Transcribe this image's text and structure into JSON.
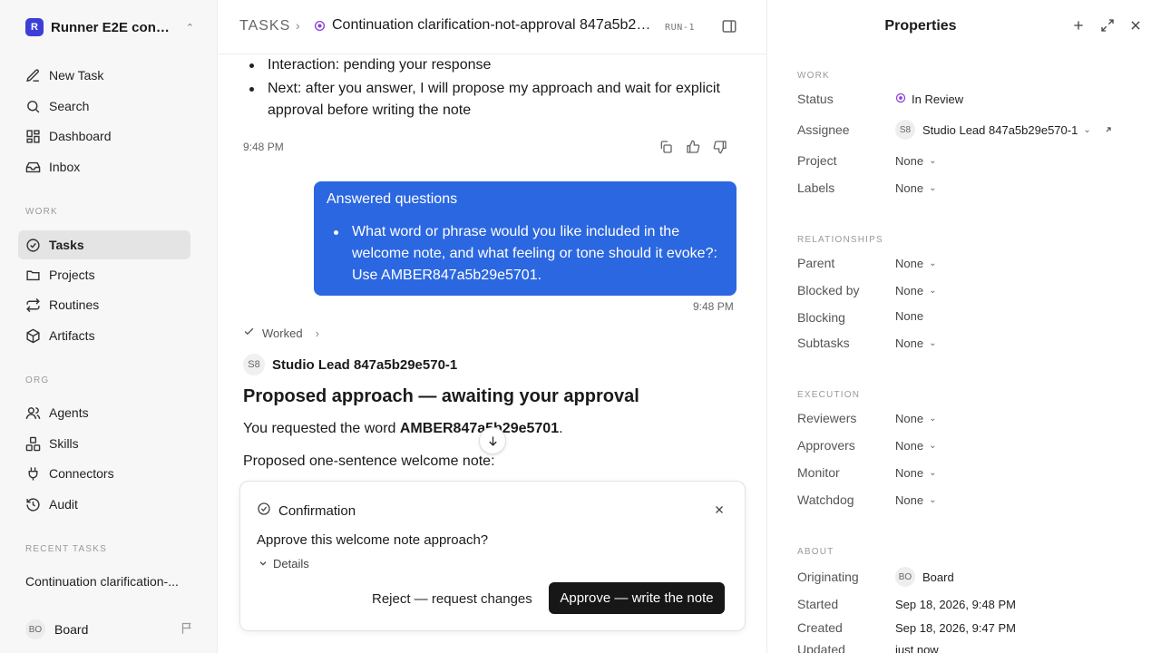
{
  "workspace": {
    "logo": "R",
    "name": "Runner E2E conti..."
  },
  "nav": {
    "new_task": "New Task",
    "search": "Search",
    "dashboard": "Dashboard",
    "inbox": "Inbox",
    "work_label": "WORK",
    "tasks": "Tasks",
    "projects": "Projects",
    "routines": "Routines",
    "artifacts": "Artifacts",
    "org_label": "ORG",
    "agents": "Agents",
    "skills": "Skills",
    "connectors": "Connectors",
    "audit": "Audit",
    "recent_label": "RECENT TASKS",
    "recent_task": "Continuation clarification-..."
  },
  "user": {
    "initials": "BO",
    "name": "Board"
  },
  "header": {
    "crumb": "TASKS",
    "title": "Continuation clarification-not-approval 847a5b29e5...",
    "run_id": "RUN-1"
  },
  "thread": {
    "bullet_1": "Interaction: pending your response",
    "bullet_2": "Next: after you answer, I will propose my approach and wait for explicit approval before writing the note",
    "time_1": "9:48 PM",
    "answer_title": "Answered questions",
    "answer_item": "What word or phrase would you like included in the welcome note, and what feeling or tone should it evoke?: Use AMBER847a5b29e5701.",
    "time_2": "9:48 PM",
    "worked": "Worked",
    "author_initials": "S8",
    "author_name": "Studio Lead 847a5b29e570-1",
    "heading": "Proposed approach — awaiting your approval",
    "requested_prefix": "You requested the word ",
    "requested_word": "AMBER847a5b29e5701",
    "requested_suffix": ".",
    "proposed": "Proposed one-sentence welcome note:"
  },
  "confirmation": {
    "title": "Confirmation",
    "question": "Approve this welcome note approach?",
    "details": "Details",
    "reject": "Reject — request changes",
    "approve": "Approve — write the note"
  },
  "properties": {
    "title": "Properties",
    "work_label": "WORK",
    "status_key": "Status",
    "status_val": "In Review",
    "assignee_key": "Assignee",
    "assignee_initials": "S8",
    "assignee_val": "Studio Lead 847a5b29e570-1",
    "project_key": "Project",
    "project_val": "None",
    "labels_key": "Labels",
    "labels_val": "None",
    "rel_label": "RELATIONSHIPS",
    "parent_key": "Parent",
    "parent_val": "None",
    "blockedby_key": "Blocked by",
    "blockedby_val": "None",
    "blocking_key": "Blocking",
    "blocking_val": "None",
    "subtasks_key": "Subtasks",
    "subtasks_val": "None",
    "exec_label": "EXECUTION",
    "reviewers_key": "Reviewers",
    "reviewers_val": "None",
    "approvers_key": "Approvers",
    "approvers_val": "None",
    "monitor_key": "Monitor",
    "monitor_val": "None",
    "watchdog_key": "Watchdog",
    "watchdog_val": "None",
    "about_label": "ABOUT",
    "originating_key": "Originating",
    "originating_initials": "BO",
    "originating_val": "Board",
    "started_key": "Started",
    "started_val": "Sep 18, 2026, 9:48 PM",
    "created_key": "Created",
    "created_val": "Sep 18, 2026, 9:47 PM",
    "updated_key": "Updated",
    "updated_val": "just now"
  },
  "colors": {
    "accent": "#2b67e0",
    "status": "#8b3fd8",
    "primary_button": "#171717"
  }
}
